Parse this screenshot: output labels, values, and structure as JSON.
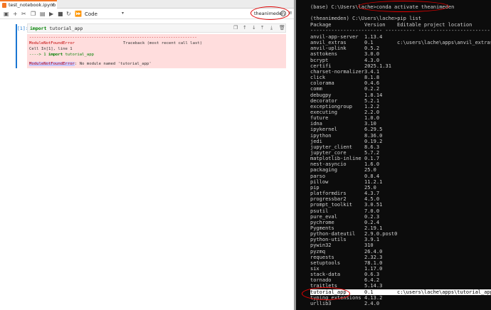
{
  "notebook": {
    "tab_title": "test_notebook.ipynb",
    "cell_type": "Code",
    "kernel_name": "theanimeden",
    "cell": {
      "prompt": "[1]:",
      "code_keyword": "import",
      "code_rest": " tutorial_app"
    },
    "error": {
      "separator": "----------------------------------------------------------------------",
      "error_name": "ModuleNotFoundError",
      "traceback_label": "Traceback (most recent call last)",
      "cell_ref": "Cell In[1], line 1",
      "arrow": "----> 1 ",
      "arrow_code_kw": "import",
      "arrow_code_rest": " tutorial_app",
      "final_name": "ModuleNotFoundError",
      "final_message": ": No module named 'tutorial_app'"
    }
  },
  "terminal": {
    "line1_prefix": "(base) C:\\Users\\lache>",
    "line1_cmd": "conda activate theanimeden",
    "line2_prefix": "(theanimeden) C:\\Users\\lache>",
    "line2_cmd": "pip list",
    "header": {
      "package": "Package",
      "version": "Version",
      "location": "Editable project location"
    },
    "header_sep": "------------------------ ---------- ---------------------------------",
    "packages": [
      {
        "name": "anvil-app-server",
        "version": "1.13.4",
        "location": ""
      },
      {
        "name": "anvil_extras",
        "version": "0.1",
        "location": "c:\\users\\lache\\apps\\anvil_extras"
      },
      {
        "name": "anvil-uplink",
        "version": "0.5.2",
        "location": ""
      },
      {
        "name": "asttokens",
        "version": "3.0.0",
        "location": ""
      },
      {
        "name": "bcrypt",
        "version": "4.3.0",
        "location": ""
      },
      {
        "name": "certifi",
        "version": "2025.1.31",
        "location": ""
      },
      {
        "name": "charset-normalizer",
        "version": "3.4.1",
        "location": ""
      },
      {
        "name": "click",
        "version": "8.1.8",
        "location": ""
      },
      {
        "name": "colorama",
        "version": "0.4.6",
        "location": ""
      },
      {
        "name": "comm",
        "version": "0.2.2",
        "location": ""
      },
      {
        "name": "debugpy",
        "version": "1.8.14",
        "location": ""
      },
      {
        "name": "decorator",
        "version": "5.2.1",
        "location": ""
      },
      {
        "name": "exceptiongroup",
        "version": "1.2.2",
        "location": ""
      },
      {
        "name": "executing",
        "version": "2.2.0",
        "location": ""
      },
      {
        "name": "future",
        "version": "1.0.0",
        "location": ""
      },
      {
        "name": "idna",
        "version": "3.10",
        "location": ""
      },
      {
        "name": "ipykernel",
        "version": "6.29.5",
        "location": ""
      },
      {
        "name": "ipython",
        "version": "8.36.0",
        "location": ""
      },
      {
        "name": "jedi",
        "version": "0.19.2",
        "location": ""
      },
      {
        "name": "jupyter_client",
        "version": "8.6.3",
        "location": ""
      },
      {
        "name": "jupyter_core",
        "version": "5.7.2",
        "location": ""
      },
      {
        "name": "matplotlib-inline",
        "version": "0.1.7",
        "location": ""
      },
      {
        "name": "nest-asyncio",
        "version": "1.6.0",
        "location": ""
      },
      {
        "name": "packaging",
        "version": "25.0",
        "location": ""
      },
      {
        "name": "parso",
        "version": "0.8.4",
        "location": ""
      },
      {
        "name": "pillow",
        "version": "11.2.1",
        "location": ""
      },
      {
        "name": "pip",
        "version": "25.0",
        "location": ""
      },
      {
        "name": "platformdirs",
        "version": "4.3.7",
        "location": ""
      },
      {
        "name": "progressbar2",
        "version": "4.5.0",
        "location": ""
      },
      {
        "name": "prompt_toolkit",
        "version": "3.0.51",
        "location": ""
      },
      {
        "name": "psutil",
        "version": "7.0.0",
        "location": ""
      },
      {
        "name": "pure_eval",
        "version": "0.2.3",
        "location": ""
      },
      {
        "name": "pychrome",
        "version": "0.2.4",
        "location": ""
      },
      {
        "name": "Pygments",
        "version": "2.19.1",
        "location": ""
      },
      {
        "name": "python-dateutil",
        "version": "2.9.0.post0",
        "location": ""
      },
      {
        "name": "python-utils",
        "version": "3.9.1",
        "location": ""
      },
      {
        "name": "pywin32",
        "version": "310",
        "location": ""
      },
      {
        "name": "pyzmq",
        "version": "26.4.0",
        "location": ""
      },
      {
        "name": "requests",
        "version": "2.32.3",
        "location": ""
      },
      {
        "name": "setuptools",
        "version": "78.1.0",
        "location": ""
      },
      {
        "name": "six",
        "version": "1.17.0",
        "location": ""
      },
      {
        "name": "stack-data",
        "version": "0.6.3",
        "location": ""
      },
      {
        "name": "tornado",
        "version": "6.4.2",
        "location": ""
      },
      {
        "name": "traitlets",
        "version": "5.14.3",
        "location": ""
      },
      {
        "name": "tutorial_app",
        "version": "0.1",
        "location": "c:\\users\\lache\\apps\\tutorial_app"
      },
      {
        "name": "typing_extensions",
        "version": "4.13.2",
        "location": ""
      },
      {
        "name": "urllib3",
        "version": "2.4.0",
        "location": ""
      }
    ],
    "highlight_index": 44
  },
  "colors": {
    "accent": "#1976d2",
    "error_bg": "#ffdddd",
    "annotation_red": "#e00000",
    "terminal_bg": "#0c0c0c"
  },
  "icons": {
    "toolbar": [
      "save-icon",
      "add-cell-icon",
      "cut-icon",
      "copy-icon",
      "paste-icon",
      "run-icon",
      "stop-icon",
      "restart-icon",
      "run-all-icon"
    ]
  }
}
